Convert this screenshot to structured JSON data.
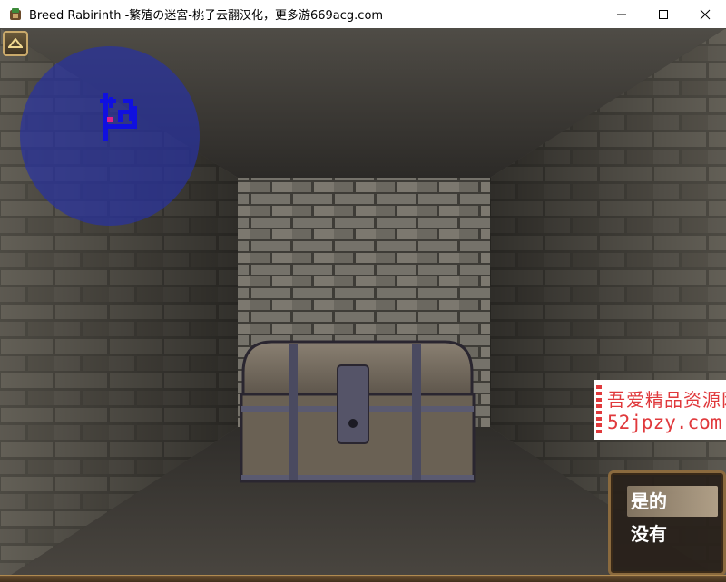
{
  "window": {
    "title": "Breed Rabirinth -繁殖の迷宮-桃子云翻汉化，更多游669acg.com"
  },
  "watermark": {
    "line1": "吾爱精品资源网",
    "line2": "52jpzy.com"
  },
  "choices": {
    "yes_label": "是的",
    "no_label": "没有"
  },
  "icons": {
    "minimize": "minimize-icon",
    "maximize": "maximize-icon",
    "close": "close-icon",
    "menu": "menu-up-arrow-icon"
  },
  "colors": {
    "minimap": "#2832a0",
    "minimap_path": "#1010e0",
    "player_marker": "#e0208c",
    "watermark_red": "#e0393c"
  }
}
